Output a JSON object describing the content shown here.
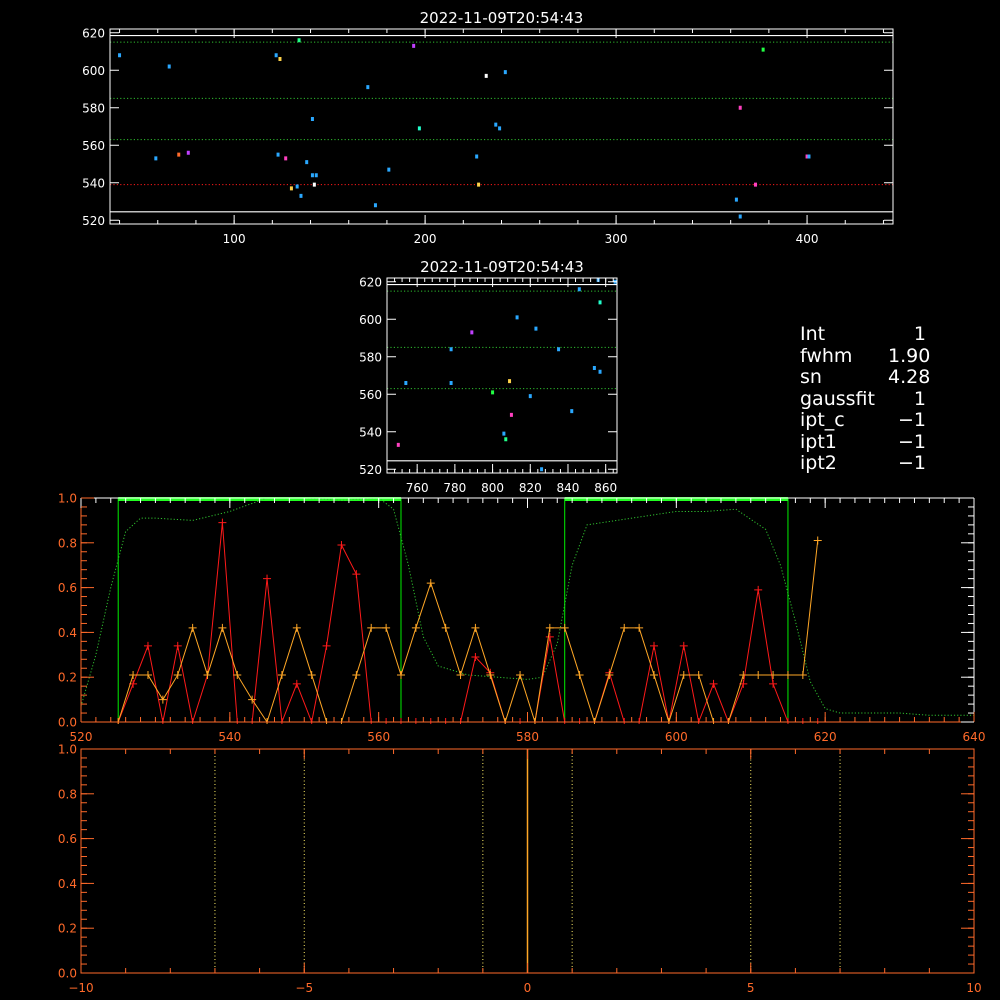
{
  "colors": {
    "background": "#000000",
    "white": "#ffffff",
    "green_dots": "#2fbf2f",
    "red_line": "#ff1a1a",
    "orange": "#ffa726",
    "box_green": "#00ee00",
    "bright_green": "#22ff22",
    "axis_orange": "#ff6a2a"
  },
  "info_panel": {
    "rows": [
      {
        "key": "Int",
        "value": "1"
      },
      {
        "key": "fwhm",
        "value": "1.90"
      },
      {
        "key": "sn",
        "value": "4.28"
      },
      {
        "key": "gaussfit",
        "value": "1"
      },
      {
        "key": "ipt_c",
        "value": "−1"
      },
      {
        "key": "ipt1",
        "value": "−1"
      },
      {
        "key": "ipt2",
        "value": "−1"
      }
    ]
  },
  "chart_data": [
    {
      "type": "scatter",
      "title": "2022-11-09T20:54:43",
      "xlim": [
        35,
        445
      ],
      "ylim": [
        518,
        622
      ],
      "xticks": [
        100,
        200,
        300,
        400
      ],
      "yticks": [
        520,
        540,
        560,
        580,
        600,
        620
      ],
      "hlines": [
        {
          "y": 615,
          "style": "dotted",
          "color": "green"
        },
        {
          "y": 585,
          "style": "dotted",
          "color": "green"
        },
        {
          "y": 563,
          "style": "dotted",
          "color": "green"
        },
        {
          "y": 539,
          "style": "dotted",
          "color": "red"
        },
        {
          "y": 524.5,
          "style": "solid",
          "color": "white"
        },
        {
          "y": 618.5,
          "style": "solid",
          "color": "white"
        }
      ],
      "points": [
        {
          "x": 40,
          "y": 608,
          "c": "#2aa8ff"
        },
        {
          "x": 59,
          "y": 553,
          "c": "#2aa8ff"
        },
        {
          "x": 66,
          "y": 602,
          "c": "#2aa8ff"
        },
        {
          "x": 71,
          "y": 555,
          "c": "#ff6a2a"
        },
        {
          "x": 76,
          "y": 556,
          "c": "#c040ff"
        },
        {
          "x": 122,
          "y": 608,
          "c": "#2aa8ff"
        },
        {
          "x": 124,
          "y": 606,
          "c": "#ffd24a"
        },
        {
          "x": 123,
          "y": 555,
          "c": "#2aa8ff"
        },
        {
          "x": 127,
          "y": 553,
          "c": "#ff40c0"
        },
        {
          "x": 130,
          "y": 537,
          "c": "#ffd24a"
        },
        {
          "x": 133,
          "y": 538,
          "c": "#2aa8ff"
        },
        {
          "x": 134,
          "y": 616,
          "c": "#22ff88"
        },
        {
          "x": 135,
          "y": 533,
          "c": "#2aa8ff"
        },
        {
          "x": 138,
          "y": 551,
          "c": "#2aa8ff"
        },
        {
          "x": 141,
          "y": 574,
          "c": "#2aa8ff"
        },
        {
          "x": 141,
          "y": 544,
          "c": "#2aa8ff"
        },
        {
          "x": 143,
          "y": 544,
          "c": "#2aa8ff"
        },
        {
          "x": 142,
          "y": 539,
          "c": "#ffffff"
        },
        {
          "x": 170,
          "y": 591,
          "c": "#2aa8ff"
        },
        {
          "x": 174,
          "y": 528,
          "c": "#2aa8ff"
        },
        {
          "x": 181,
          "y": 547,
          "c": "#2aa8ff"
        },
        {
          "x": 194,
          "y": 613,
          "c": "#c040ff"
        },
        {
          "x": 197,
          "y": 569,
          "c": "#22ffcc"
        },
        {
          "x": 227,
          "y": 554,
          "c": "#2aa8ff"
        },
        {
          "x": 228,
          "y": 539,
          "c": "#ffd24a"
        },
        {
          "x": 232,
          "y": 597,
          "c": "#ffffff"
        },
        {
          "x": 237,
          "y": 571,
          "c": "#2aa8ff"
        },
        {
          "x": 239,
          "y": 569,
          "c": "#2aa8ff"
        },
        {
          "x": 242,
          "y": 599,
          "c": "#2aa8ff"
        },
        {
          "x": 363,
          "y": 531,
          "c": "#2aa8ff"
        },
        {
          "x": 365,
          "y": 522,
          "c": "#2aa8ff"
        },
        {
          "x": 365,
          "y": 580,
          "c": "#ff40c0"
        },
        {
          "x": 373,
          "y": 539,
          "c": "#ff40c0"
        },
        {
          "x": 377,
          "y": 611,
          "c": "#22ff44"
        },
        {
          "x": 400,
          "y": 554,
          "c": "#ff40c0"
        },
        {
          "x": 401,
          "y": 554,
          "c": "#2aa8ff"
        }
      ]
    },
    {
      "type": "scatter",
      "title": "2022-11-09T20:54:43",
      "xlim": [
        744,
        866
      ],
      "ylim": [
        518,
        622
      ],
      "xticks": [
        760,
        780,
        800,
        820,
        840,
        860
      ],
      "yticks": [
        520,
        540,
        560,
        580,
        600,
        620
      ],
      "hlines": [
        {
          "y": 615,
          "style": "dotted",
          "color": "green"
        },
        {
          "y": 585,
          "style": "dotted",
          "color": "green"
        },
        {
          "y": 563,
          "style": "dotted",
          "color": "green"
        },
        {
          "y": 524.5,
          "style": "solid",
          "color": "white"
        },
        {
          "y": 618.5,
          "style": "solid",
          "color": "white"
        }
      ],
      "points": [
        {
          "x": 750,
          "y": 533,
          "c": "#ff40c0"
        },
        {
          "x": 754,
          "y": 566,
          "c": "#2aa8ff"
        },
        {
          "x": 778,
          "y": 584,
          "c": "#2aa8ff"
        },
        {
          "x": 778,
          "y": 566,
          "c": "#2aa8ff"
        },
        {
          "x": 789,
          "y": 593,
          "c": "#c040ff"
        },
        {
          "x": 800,
          "y": 561,
          "c": "#22ff44"
        },
        {
          "x": 806,
          "y": 539,
          "c": "#2aa8ff"
        },
        {
          "x": 807,
          "y": 536,
          "c": "#22ff88"
        },
        {
          "x": 809,
          "y": 567,
          "c": "#ffd24a"
        },
        {
          "x": 810,
          "y": 549,
          "c": "#ff40c0"
        },
        {
          "x": 813,
          "y": 601,
          "c": "#2aa8ff"
        },
        {
          "x": 820,
          "y": 559,
          "c": "#2aa8ff"
        },
        {
          "x": 823,
          "y": 595,
          "c": "#2aa8ff"
        },
        {
          "x": 826,
          "y": 520,
          "c": "#2aa8ff"
        },
        {
          "x": 835,
          "y": 584,
          "c": "#2aa8ff"
        },
        {
          "x": 842,
          "y": 551,
          "c": "#2aa8ff"
        },
        {
          "x": 846,
          "y": 616,
          "c": "#2aa8ff"
        },
        {
          "x": 854,
          "y": 574,
          "c": "#2aa8ff"
        },
        {
          "x": 856,
          "y": 621,
          "c": "#2aa8ff"
        },
        {
          "x": 857,
          "y": 609,
          "c": "#22ffcc"
        },
        {
          "x": 857,
          "y": 572,
          "c": "#2aa8ff"
        },
        {
          "x": 865,
          "y": 620,
          "c": "#2aa8ff"
        }
      ]
    },
    {
      "type": "line",
      "title": "",
      "xlim": [
        520,
        640
      ],
      "ylim": [
        0,
        1
      ],
      "xticks": [
        520,
        540,
        560,
        580,
        600,
        620,
        640
      ],
      "yticks": [
        0.0,
        0.2,
        0.4,
        0.6,
        0.8,
        1.0
      ],
      "boxes": [
        {
          "x0": 525,
          "x1": 563
        },
        {
          "x0": 585,
          "x1": 615
        }
      ],
      "series": [
        {
          "style": "dotted",
          "color": "green",
          "x": [
            520,
            522,
            524,
            526,
            528,
            530,
            535,
            540,
            545,
            550,
            555,
            560,
            562,
            564,
            566,
            568,
            572,
            576,
            580,
            582,
            584,
            586,
            588,
            592,
            596,
            600,
            604,
            608,
            612,
            614,
            616,
            618,
            620,
            622,
            626,
            630,
            634,
            638,
            640
          ],
          "y": [
            0.07,
            0.3,
            0.6,
            0.85,
            0.91,
            0.91,
            0.9,
            0.94,
            1.0,
            1.0,
            0.99,
            1.0,
            0.95,
            0.7,
            0.38,
            0.25,
            0.21,
            0.2,
            0.19,
            0.2,
            0.35,
            0.7,
            0.88,
            0.9,
            0.92,
            0.94,
            0.94,
            0.95,
            0.86,
            0.7,
            0.45,
            0.18,
            0.06,
            0.04,
            0.04,
            0.04,
            0.03,
            0.03,
            0.03
          ]
        },
        {
          "style": "solid",
          "color": "red",
          "x": [
            525,
            527,
            529,
            531,
            533,
            535,
            537,
            539,
            541,
            543,
            545,
            547,
            549,
            551,
            553,
            555,
            557,
            559,
            561,
            563,
            565,
            567,
            569,
            571,
            573,
            575,
            577,
            579,
            581,
            583,
            585,
            587,
            589,
            591,
            593,
            595,
            597,
            599,
            601,
            603,
            605,
            607,
            609,
            611,
            613,
            615,
            617,
            619
          ],
          "y": [
            0.0,
            0.17,
            0.34,
            0.0,
            0.34,
            0.0,
            0.21,
            0.89,
            0.0,
            0.0,
            0.64,
            0.0,
            0.17,
            0.0,
            0.34,
            0.79,
            0.66,
            0.0,
            0.0,
            0.0,
            0.0,
            0.0,
            0.0,
            0.0,
            0.29,
            0.22,
            0.0,
            0.0,
            0.0,
            0.38,
            0.0,
            0.0,
            0.0,
            0.22,
            0.0,
            0.0,
            0.34,
            0.0,
            0.34,
            0.0,
            0.17,
            0.0,
            0.17,
            0.59,
            0.17,
            0.0,
            0.0,
            0.0
          ]
        },
        {
          "style": "solid",
          "color": "orange",
          "x": [
            525,
            527,
            529,
            531,
            533,
            535,
            537,
            539,
            541,
            543,
            545,
            547,
            549,
            551,
            553,
            555,
            557,
            559,
            561,
            563,
            565,
            567,
            569,
            571,
            573,
            575,
            577,
            579,
            581,
            583,
            585,
            587,
            589,
            591,
            593,
            595,
            597,
            599,
            601,
            603,
            605,
            607,
            609,
            611,
            613,
            615,
            617,
            619
          ],
          "y": [
            0.0,
            0.21,
            0.21,
            0.1,
            0.21,
            0.42,
            0.21,
            0.42,
            0.21,
            0.1,
            0.0,
            0.21,
            0.42,
            0.21,
            0.0,
            0.0,
            0.21,
            0.42,
            0.42,
            0.21,
            0.42,
            0.62,
            0.42,
            0.21,
            0.42,
            0.21,
            0.0,
            0.21,
            0.0,
            0.42,
            0.42,
            0.21,
            0.0,
            0.21,
            0.42,
            0.42,
            0.21,
            0.0,
            0.21,
            0.21,
            0.0,
            0.0,
            0.21,
            0.21,
            0.21,
            0.21,
            0.21,
            0.81
          ]
        }
      ]
    },
    {
      "type": "line",
      "title": "",
      "xlim": [
        -10,
        10
      ],
      "ylim": [
        0,
        1
      ],
      "xticks": [
        -10,
        -5,
        0,
        5,
        10
      ],
      "yticks": [
        0.0,
        0.2,
        0.4,
        0.6,
        0.8,
        1.0
      ],
      "vlines": [
        {
          "x": -7,
          "style": "dotted"
        },
        {
          "x": -5,
          "style": "dotted"
        },
        {
          "x": -1,
          "style": "dotted"
        },
        {
          "x": 0,
          "style": "solid"
        },
        {
          "x": 1,
          "style": "dotted"
        },
        {
          "x": 5,
          "style": "dotted"
        },
        {
          "x": 7,
          "style": "dotted"
        }
      ]
    }
  ]
}
